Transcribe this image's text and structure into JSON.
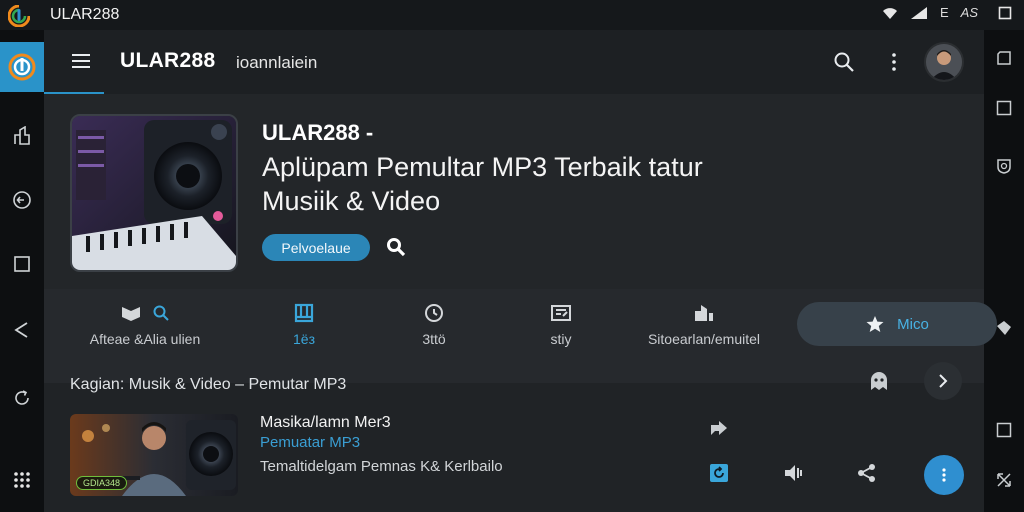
{
  "status_bar": {
    "app_name": "ULAR288",
    "indicators": [
      "wifi-icon",
      "signal-icon"
    ],
    "texts": [
      "E",
      "AS"
    ]
  },
  "left_rail": {
    "items": [
      "logo-icon",
      "share-icon",
      "back-circle-icon",
      "square-icon",
      "triangle-back-icon",
      "refresh-icon",
      "grid-icon"
    ]
  },
  "right_rail": {
    "items": [
      "copy-icon",
      "square-icon",
      "shield-icon",
      "diamond-icon",
      "square-icon",
      "expand-icon"
    ]
  },
  "app_bar": {
    "title": "ULAR288",
    "subtitle": "ioannlaiein",
    "icons": [
      "menu-icon",
      "search-icon",
      "more-vert-icon",
      "avatar"
    ]
  },
  "hero": {
    "title": "ULAR288 -",
    "heading": "Aplüpam Pemultar MP3 Terbaik tatur Musiik & Video",
    "pill_label": "Pelvoelaue"
  },
  "tabs": {
    "items": [
      {
        "label": "Afteae &Alia ulien",
        "icon": "music-icon",
        "active": false
      },
      {
        "label": "1ёз",
        "icon": "grid-icon",
        "active": true
      },
      {
        "label": "3ttö",
        "icon": "disc-icon",
        "active": false
      },
      {
        "label": "stiy",
        "icon": "video-icon",
        "active": false
      },
      {
        "label": "Sitoearlan/emuitel",
        "icon": "library-icon",
        "active": false
      }
    ],
    "selected": {
      "label": "Mico",
      "icon": "star-icon"
    }
  },
  "category": {
    "text": "Kagian: Musik & Video – Pemutar MP3"
  },
  "track": {
    "badge": "GDIA348",
    "title": "Masika/lamn Mer3",
    "subtitle": "Pemuatar MP3",
    "description": "Temaltidelgam Pemnas K& Kerlbailo"
  },
  "colors": {
    "accent": "#2a93c9",
    "accent_text": "#3aa6da",
    "background": "#202326",
    "pill": "#2b86b7",
    "fab": "#2f8fd0"
  }
}
